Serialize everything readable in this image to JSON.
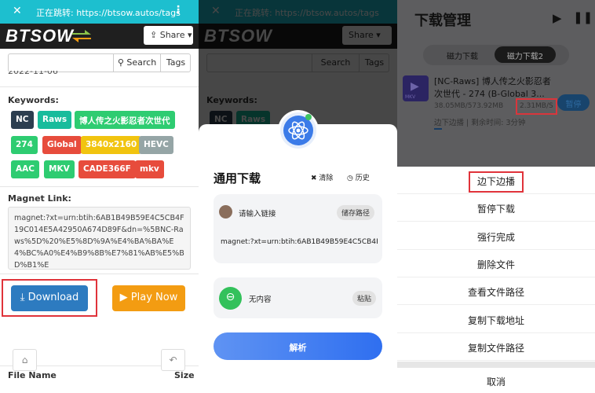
{
  "left": {
    "topbar": {
      "close": "✕",
      "url": "正在跳转: https://btsow.autos/tags",
      "menu": "⋮"
    },
    "header": {
      "logo": "BTSOW",
      "share": "Share ▾"
    },
    "search": {
      "placeholder": "",
      "search_label": "Search",
      "tags_label": "Tags"
    },
    "date_partial": "2022-11-06",
    "keywords_label": "Keywords:",
    "tags": [
      {
        "label": "NC",
        "color": "#2c3e50"
      },
      {
        "label": "Raws",
        "color": "#18bc9c"
      },
      {
        "label": "博人传之火影忍者次世代",
        "color": "#2ecc71"
      },
      {
        "label": "274",
        "color": "#2ecc71"
      },
      {
        "label": "Global",
        "color": "#e74c3c"
      },
      {
        "label": "3840x2160",
        "color": "#f1c40f"
      },
      {
        "label": "HEVC",
        "color": "#95a5a6"
      },
      {
        "label": "AAC",
        "color": "#2ecc71"
      },
      {
        "label": "MKV",
        "color": "#2ecc71"
      },
      {
        "label": "CADE366F",
        "color": "#e74c3c"
      },
      {
        "label": "mkv",
        "color": "#e74c3c"
      }
    ],
    "magnet_label": "Magnet Link:",
    "magnet_value": "magnet:?xt=urn:btih:6AB1B49B59E4C5CB4F19C014E5A42950A674D89F&dn=%5BNC-Raws%5D%20%E5%8D%9A%E4%BA%BA%E4%BC%A0%E4%B9%8B%E7%81%AB%E5%BD%B1%E",
    "download_label": "Download",
    "play_label": "Play Now",
    "file_name_label": "File Name",
    "size_label": "Size"
  },
  "middle": {
    "title": "通用下载",
    "clear": "清除",
    "history": "历史",
    "input_placeholder": "请输入链接",
    "save_path": "储存路径",
    "magnet_preview": "magnet:?xt=urn:btih:6AB1B49B59E4C5CB4F",
    "clipboard_text": "无内容",
    "paste": "粘贴",
    "parse": "解析"
  },
  "right": {
    "title": "下载管理",
    "tabs": [
      "磁力下载",
      "磁力下载2"
    ],
    "active_tab": 1,
    "item": {
      "title": "[NC-Raws] 博人传之火影忍者次世代 - 274 (B-Global 3...",
      "thumb_label": "MKV",
      "size": "38.05MB/573.92MB",
      "speed": "2.31MB/S",
      "pause": "暂停",
      "status": "边下边播 | 剩余时间: 3分钟",
      "progress": 0.066
    },
    "menu": [
      "边下边播",
      "暂停下载",
      "强行完成",
      "删除文件",
      "查看文件路径",
      "复制下载地址",
      "复制文件路径"
    ],
    "cancel": "取消"
  }
}
